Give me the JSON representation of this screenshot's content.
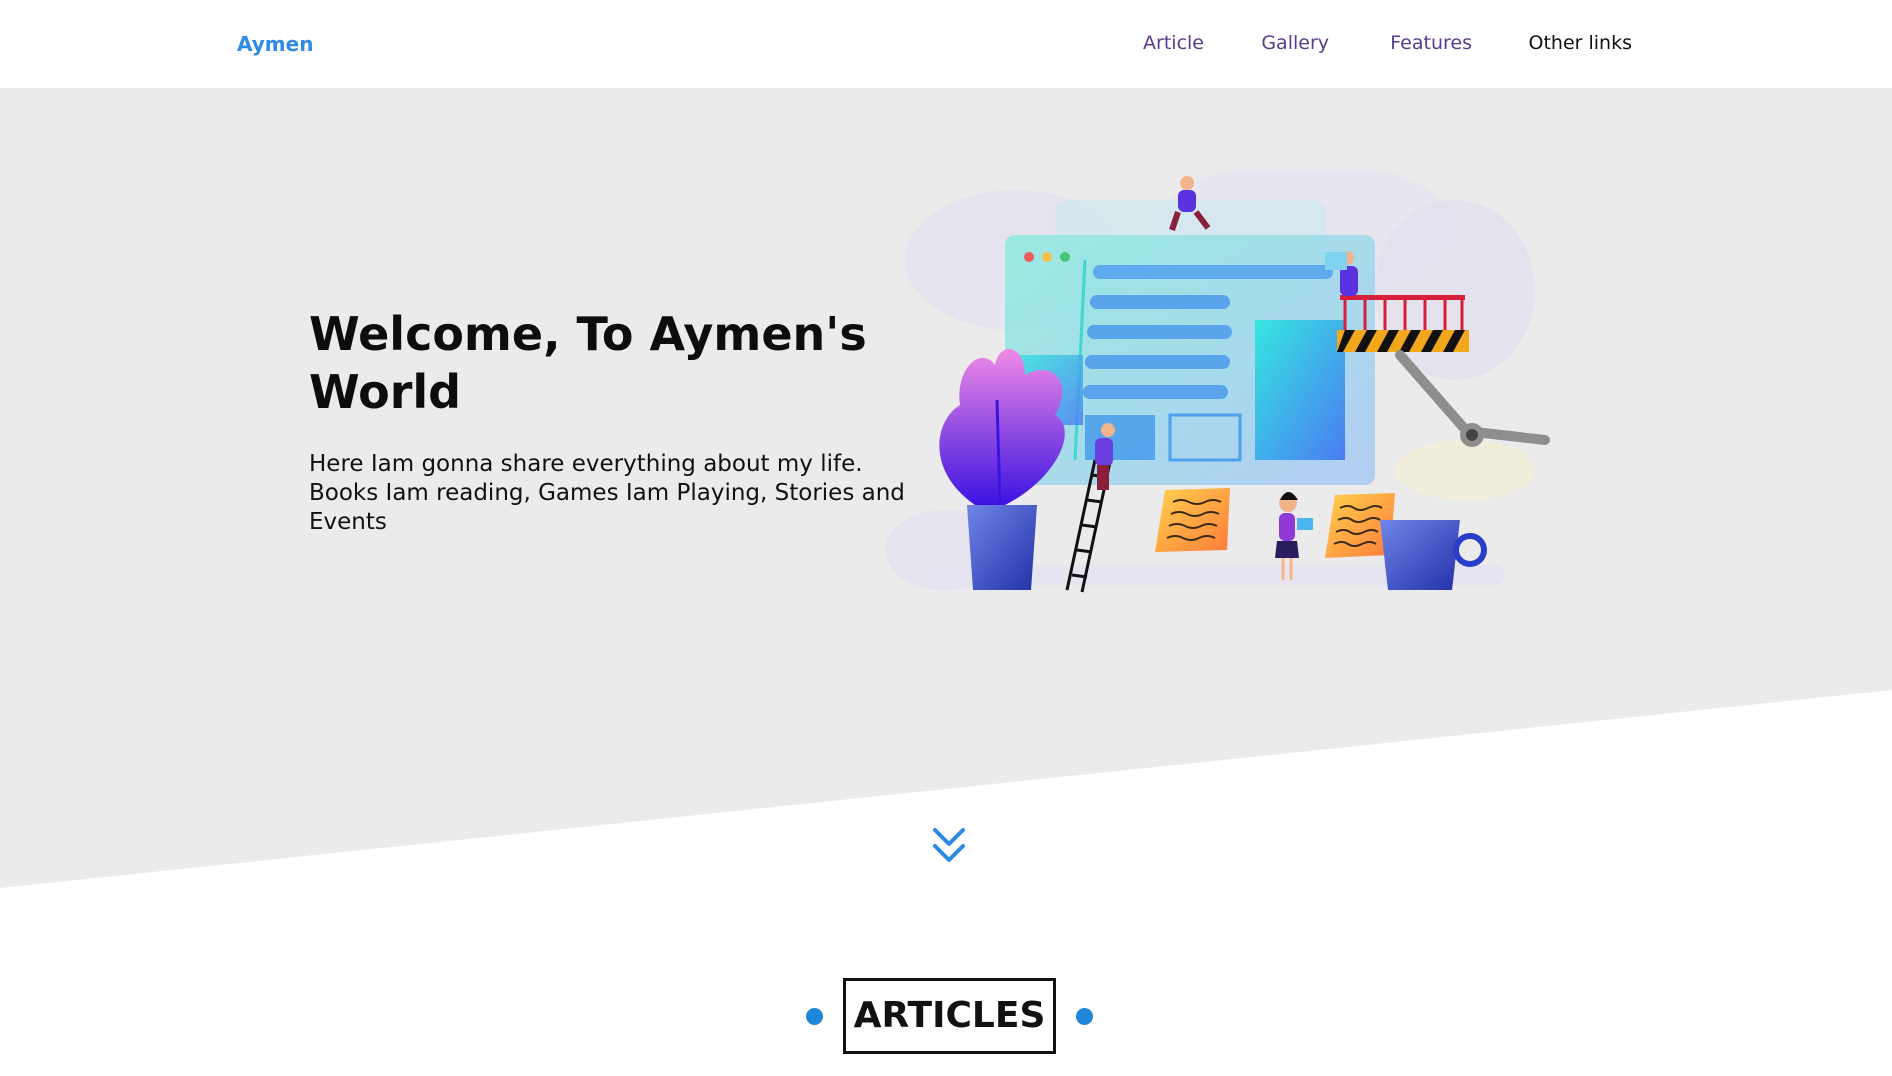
{
  "header": {
    "logo": "Aymen",
    "nav": [
      {
        "label": "Article"
      },
      {
        "label": "Gallery"
      },
      {
        "label": "Features"
      },
      {
        "label": "Other links"
      }
    ]
  },
  "hero": {
    "title": "Welcome, To Aymen's World",
    "text": "Here Iam gonna share everything about my life. Books Iam reading, Games Iam Playing, Stories and Events",
    "illustration": "website-builders-illustration"
  },
  "scroll": {
    "icon": "double-chevron-down-icon"
  },
  "articles": {
    "heading": "ARTICLES"
  },
  "colors": {
    "accent": "#2d8ae5",
    "hero_bg": "#ebebeb",
    "visited_link": "#5b3b8c"
  }
}
